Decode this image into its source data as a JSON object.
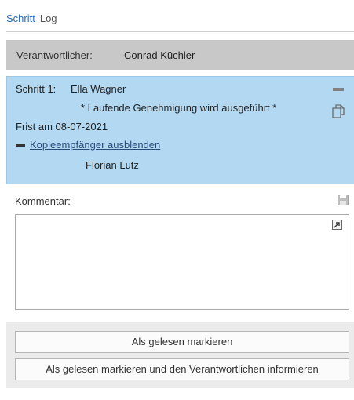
{
  "tabs": [
    {
      "label": "Schritt",
      "active": true
    },
    {
      "label": "Log",
      "active": false
    }
  ],
  "owner": {
    "label": "Verantwortlicher:",
    "name": "Conrad Küchler"
  },
  "step": {
    "label": "Schritt 1:",
    "assignee": "Ella Wagner",
    "status": "* Laufende Genehmigung wird ausgeführt *",
    "deadline": "Frist am 08-07-2021",
    "toggle_link": "Kopieempfänger ausblenden",
    "cc_recipient": "Florian Lutz"
  },
  "comment": {
    "label": "Kommentar:",
    "value": ""
  },
  "buttons": {
    "mark_read": "Als gelesen markieren",
    "mark_read_notify": "Als gelesen markieren und den Verantwortlichen informieren"
  },
  "colors": {
    "accent": "#2a6bc4",
    "step_bg": "#b3d9f2",
    "owner_bg": "#c8c8c8",
    "button_area_bg": "#ebebeb"
  }
}
